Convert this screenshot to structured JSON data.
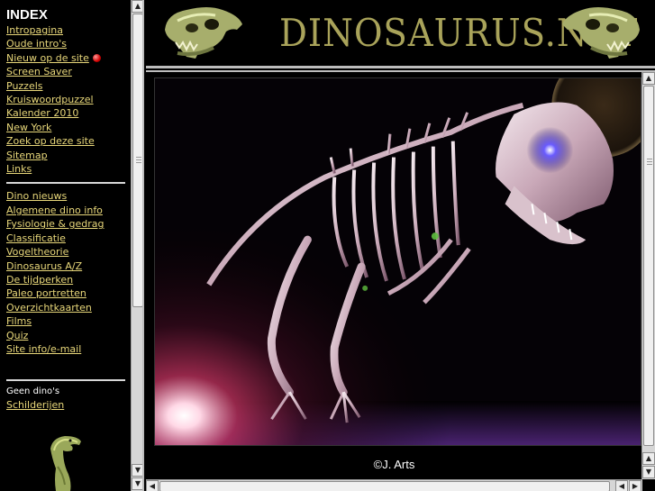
{
  "sidebar": {
    "title": "INDEX",
    "group1": [
      {
        "label": "Intropagina"
      },
      {
        "label": "Oude intro's"
      },
      {
        "label": "Nieuw op de site",
        "badge": "new-dot"
      },
      {
        "label": "Screen Saver"
      },
      {
        "label": "Puzzels"
      },
      {
        "label": "Kruiswoordpuzzel"
      },
      {
        "label": "Kalender 2010"
      },
      {
        "label": "New York"
      },
      {
        "label": "Zoek op deze site"
      },
      {
        "label": "Sitemap"
      },
      {
        "label": "Links"
      }
    ],
    "group2": [
      {
        "label": "Dino nieuws"
      },
      {
        "label": "Algemene dino info"
      },
      {
        "label": "Fysiologie & gedrag"
      },
      {
        "label": "Classificatie"
      },
      {
        "label": "Vogeltheorie"
      },
      {
        "label": "Dinosaurus A/Z"
      },
      {
        "label": "De tijdperken"
      },
      {
        "label": "Paleo portretten"
      },
      {
        "label": "Overzichtkaarten"
      },
      {
        "label": "Films"
      },
      {
        "label": "Quiz"
      },
      {
        "label": "Site info/e-mail"
      }
    ],
    "no_dino_label": "Geen dino's",
    "paintings_link": "Schilderijen"
  },
  "header": {
    "site_title": "DINOSAURUS.NET"
  },
  "main": {
    "credit": "©J. Arts"
  },
  "colors": {
    "link": "#e8d77a",
    "background": "#000000",
    "title_gold": "#a9a35a"
  },
  "icons": {
    "scroll_up": "arrow-up-icon",
    "scroll_down": "arrow-down-icon",
    "scroll_left": "arrow-left-icon",
    "scroll_right": "arrow-right-icon"
  }
}
